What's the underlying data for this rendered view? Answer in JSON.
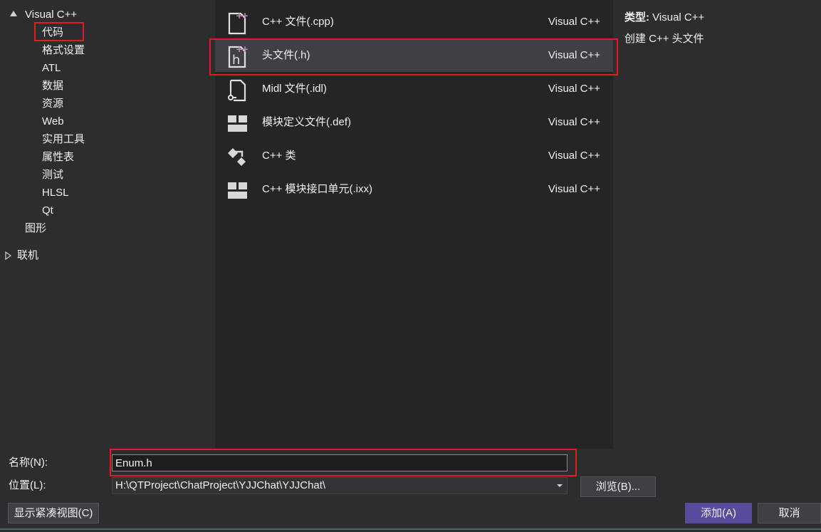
{
  "tree": {
    "root": "Visual C++",
    "children": [
      "代码",
      "格式设置",
      "ATL",
      "数据",
      "资源",
      "Web",
      "实用工具",
      "属性表",
      "测试",
      "HLSL",
      "Qt"
    ],
    "graphics": "图形",
    "online": "联机"
  },
  "templates": [
    {
      "name": "C++ 文件(.cpp)",
      "lang": "Visual C++",
      "icon": "cpp-file-icon"
    },
    {
      "name": "头文件(.h)",
      "lang": "Visual C++",
      "icon": "header-file-icon"
    },
    {
      "name": "Midl 文件(.idl)",
      "lang": "Visual C++",
      "icon": "idl-file-icon"
    },
    {
      "name": "模块定义文件(.def)",
      "lang": "Visual C++",
      "icon": "module-def-icon"
    },
    {
      "name": "C++ 类",
      "lang": "Visual C++",
      "icon": "cpp-class-icon"
    },
    {
      "name": "C++ 模块接口单元(.ixx)",
      "lang": "Visual C++",
      "icon": "module-interface-icon"
    }
  ],
  "details": {
    "type_label": "类型:",
    "type_value": "Visual C++",
    "description": "创建 C++ 头文件"
  },
  "form": {
    "name_label": "名称(N):",
    "name_value": "Enum.h",
    "location_label": "位置(L):",
    "location_value": "H:\\QTProject\\ChatProject\\YJJChat\\YJJChat\\",
    "browse_label": "浏览(B)...",
    "compact_view_label": "显示紧凑视图(C)",
    "add_label": "添加(A)",
    "cancel_label": "取消"
  },
  "colors": {
    "highlight": "#e51b23",
    "accent_button": "#5a4a9c",
    "icon_plus": "#c586c0"
  }
}
